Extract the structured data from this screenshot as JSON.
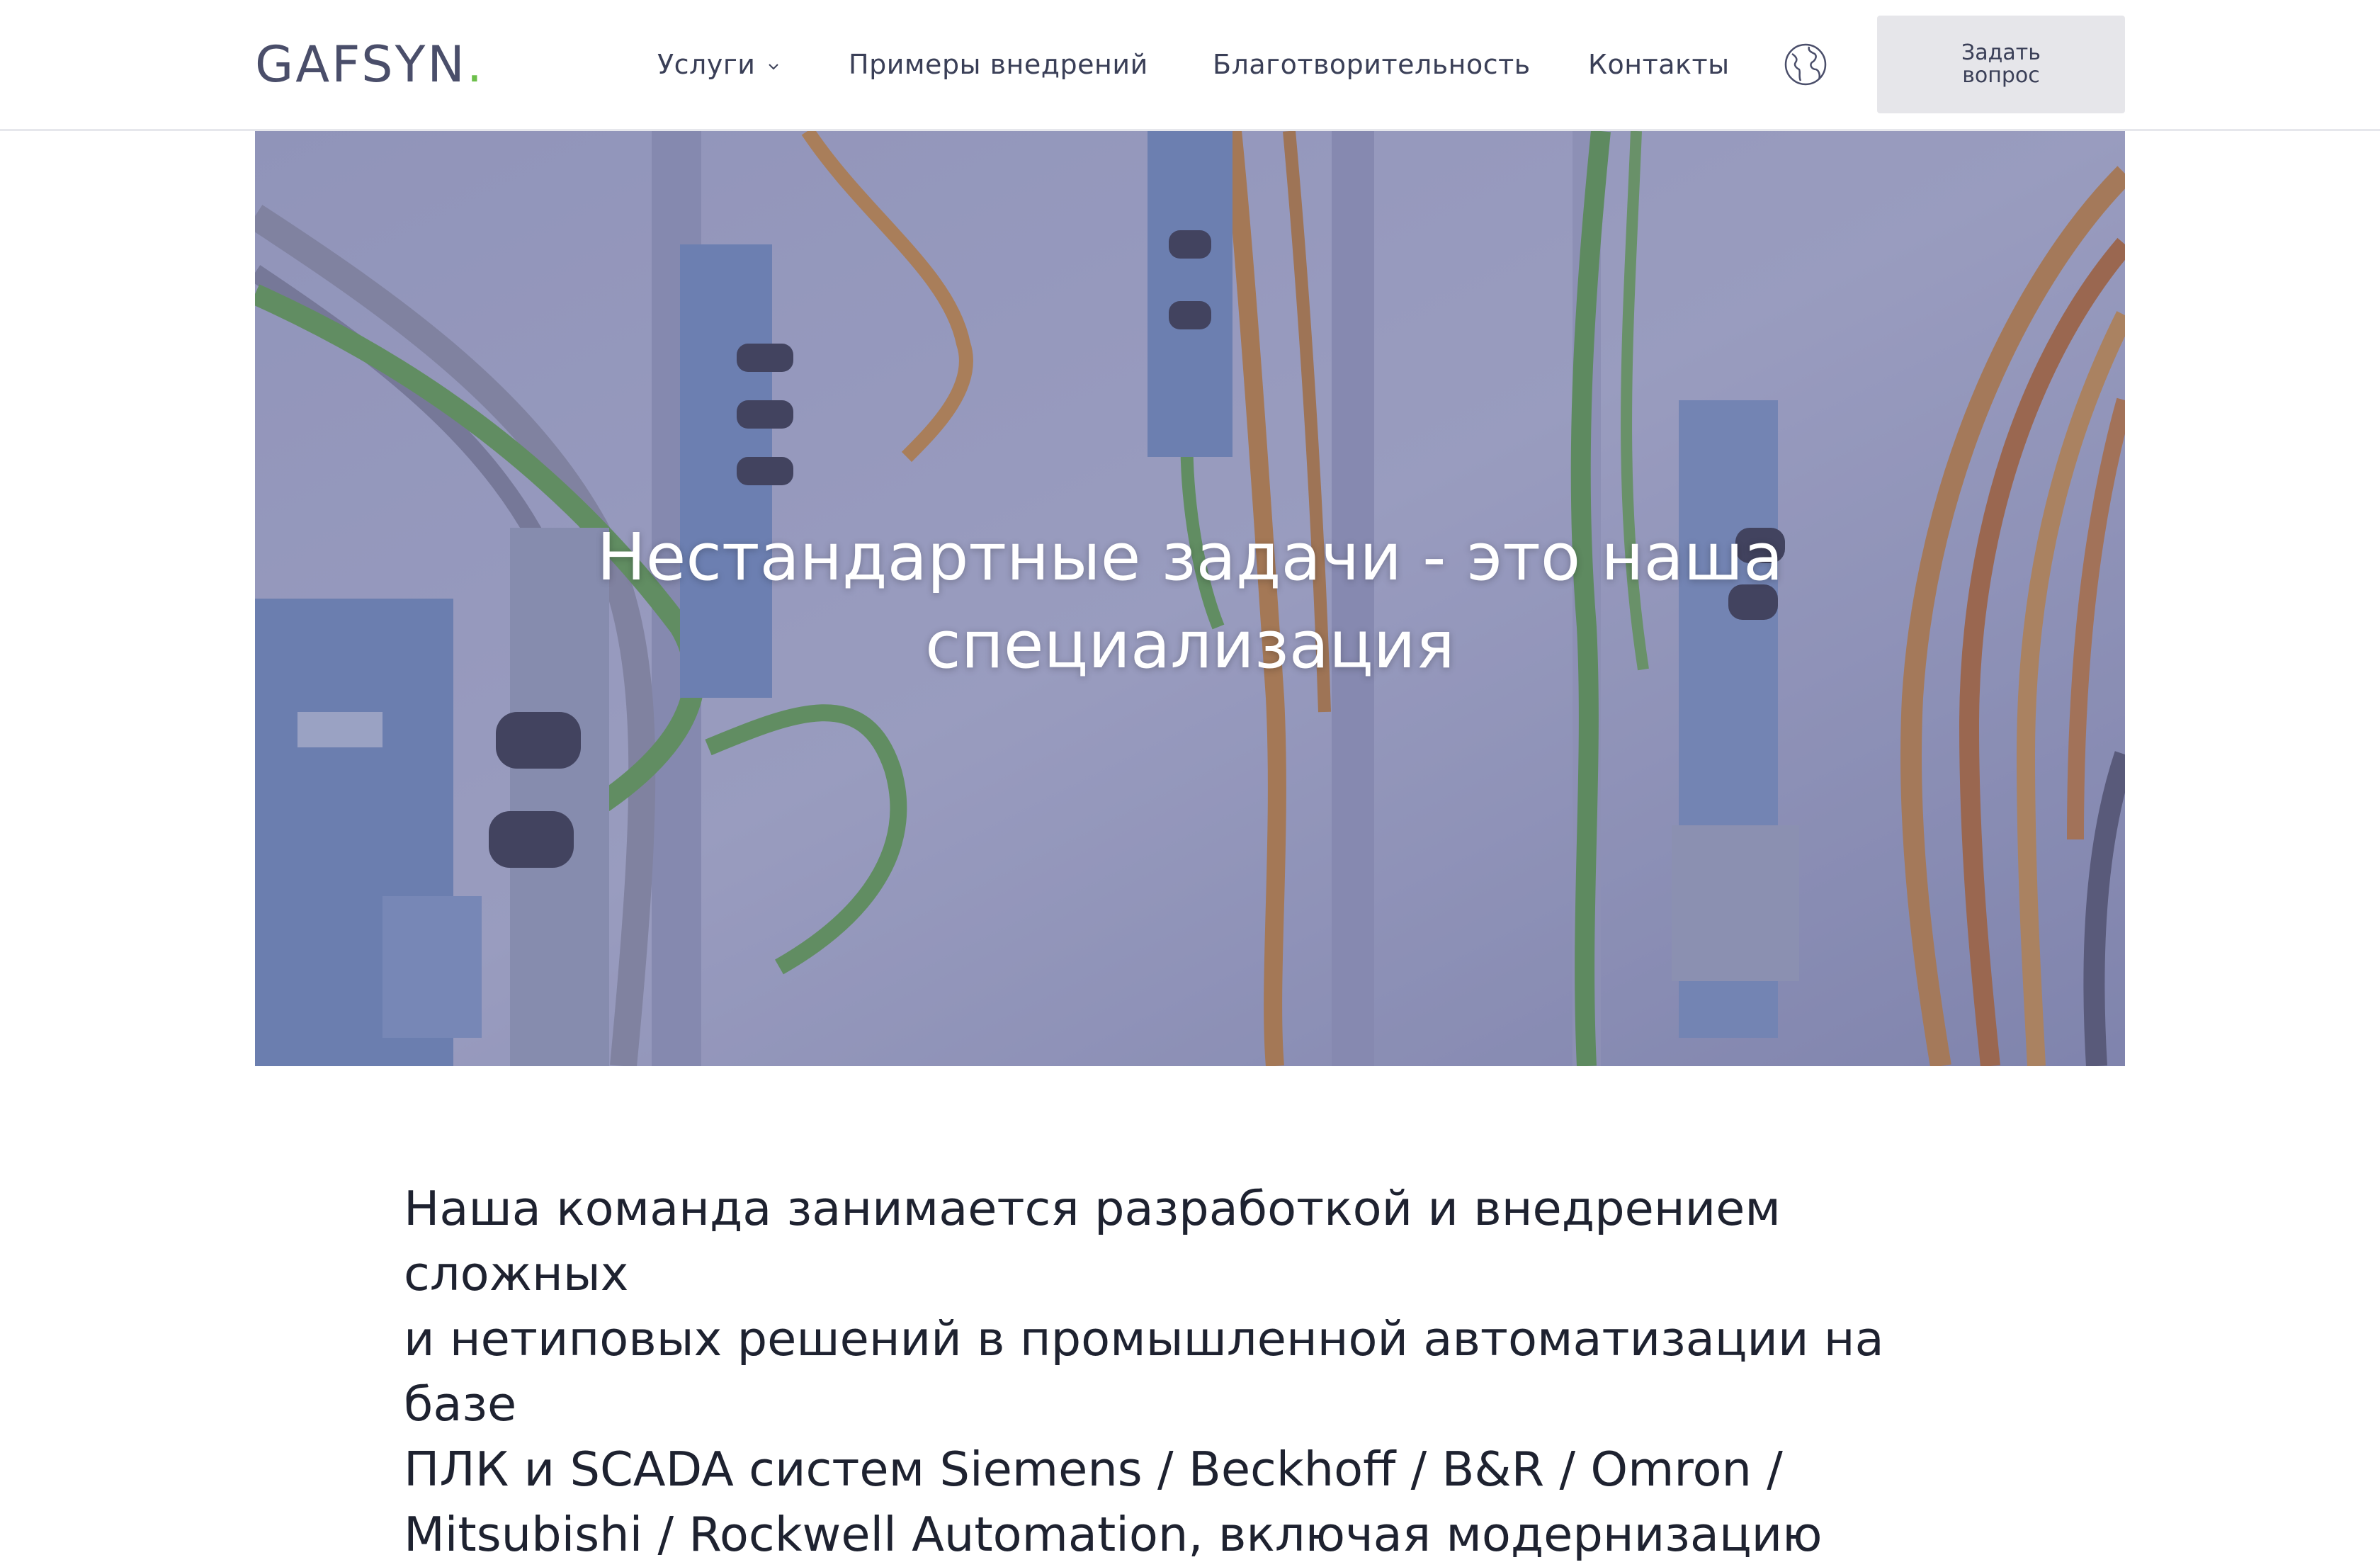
{
  "header": {
    "logo_text": "GAFSYN",
    "logo_dot": ".",
    "nav": {
      "services": "Услуги",
      "examples": "Примеры внедрений",
      "charity": "Благотворительность",
      "contacts": "Контакты"
    },
    "language_icon": "globe-icon",
    "ask_button": "Задать вопрос"
  },
  "hero": {
    "title_line1": "Нестандартные задачи - это наша",
    "title_line2": "специализация"
  },
  "intro": {
    "line1": "Наша команда занимается разработкой и внедрением сложных",
    "line2": "и нетиповых решений в промышленной автоматизации на базе",
    "line3": "ПЛК и SCADA систем Siemens / Beckhoff / B&R / Omron /",
    "line4": "Mitsubishi / Rockwell Automation, включая модернизацию"
  },
  "colors": {
    "accent_dot": "#6cbf4a",
    "button_bg": "#e6e6ea",
    "hero_overlay": "#4e528c"
  }
}
